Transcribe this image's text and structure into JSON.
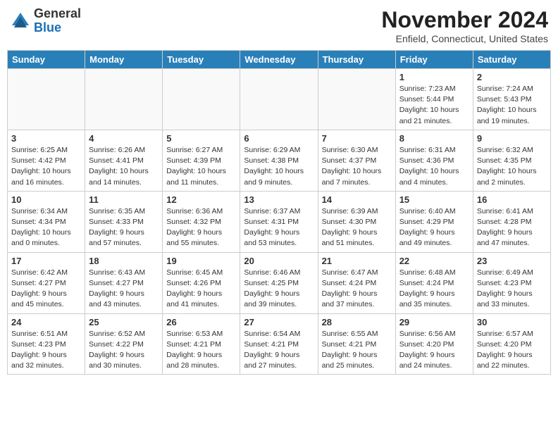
{
  "header": {
    "logo_general": "General",
    "logo_blue": "Blue",
    "month_title": "November 2024",
    "location": "Enfield, Connecticut, United States"
  },
  "days_of_week": [
    "Sunday",
    "Monday",
    "Tuesday",
    "Wednesday",
    "Thursday",
    "Friday",
    "Saturday"
  ],
  "weeks": [
    [
      {
        "day": "",
        "details": ""
      },
      {
        "day": "",
        "details": ""
      },
      {
        "day": "",
        "details": ""
      },
      {
        "day": "",
        "details": ""
      },
      {
        "day": "",
        "details": ""
      },
      {
        "day": "1",
        "details": "Sunrise: 7:23 AM\nSunset: 5:44 PM\nDaylight: 10 hours and 21 minutes."
      },
      {
        "day": "2",
        "details": "Sunrise: 7:24 AM\nSunset: 5:43 PM\nDaylight: 10 hours and 19 minutes."
      }
    ],
    [
      {
        "day": "3",
        "details": "Sunrise: 6:25 AM\nSunset: 4:42 PM\nDaylight: 10 hours and 16 minutes."
      },
      {
        "day": "4",
        "details": "Sunrise: 6:26 AM\nSunset: 4:41 PM\nDaylight: 10 hours and 14 minutes."
      },
      {
        "day": "5",
        "details": "Sunrise: 6:27 AM\nSunset: 4:39 PM\nDaylight: 10 hours and 11 minutes."
      },
      {
        "day": "6",
        "details": "Sunrise: 6:29 AM\nSunset: 4:38 PM\nDaylight: 10 hours and 9 minutes."
      },
      {
        "day": "7",
        "details": "Sunrise: 6:30 AM\nSunset: 4:37 PM\nDaylight: 10 hours and 7 minutes."
      },
      {
        "day": "8",
        "details": "Sunrise: 6:31 AM\nSunset: 4:36 PM\nDaylight: 10 hours and 4 minutes."
      },
      {
        "day": "9",
        "details": "Sunrise: 6:32 AM\nSunset: 4:35 PM\nDaylight: 10 hours and 2 minutes."
      }
    ],
    [
      {
        "day": "10",
        "details": "Sunrise: 6:34 AM\nSunset: 4:34 PM\nDaylight: 10 hours and 0 minutes."
      },
      {
        "day": "11",
        "details": "Sunrise: 6:35 AM\nSunset: 4:33 PM\nDaylight: 9 hours and 57 minutes."
      },
      {
        "day": "12",
        "details": "Sunrise: 6:36 AM\nSunset: 4:32 PM\nDaylight: 9 hours and 55 minutes."
      },
      {
        "day": "13",
        "details": "Sunrise: 6:37 AM\nSunset: 4:31 PM\nDaylight: 9 hours and 53 minutes."
      },
      {
        "day": "14",
        "details": "Sunrise: 6:39 AM\nSunset: 4:30 PM\nDaylight: 9 hours and 51 minutes."
      },
      {
        "day": "15",
        "details": "Sunrise: 6:40 AM\nSunset: 4:29 PM\nDaylight: 9 hours and 49 minutes."
      },
      {
        "day": "16",
        "details": "Sunrise: 6:41 AM\nSunset: 4:28 PM\nDaylight: 9 hours and 47 minutes."
      }
    ],
    [
      {
        "day": "17",
        "details": "Sunrise: 6:42 AM\nSunset: 4:27 PM\nDaylight: 9 hours and 45 minutes."
      },
      {
        "day": "18",
        "details": "Sunrise: 6:43 AM\nSunset: 4:27 PM\nDaylight: 9 hours and 43 minutes."
      },
      {
        "day": "19",
        "details": "Sunrise: 6:45 AM\nSunset: 4:26 PM\nDaylight: 9 hours and 41 minutes."
      },
      {
        "day": "20",
        "details": "Sunrise: 6:46 AM\nSunset: 4:25 PM\nDaylight: 9 hours and 39 minutes."
      },
      {
        "day": "21",
        "details": "Sunrise: 6:47 AM\nSunset: 4:24 PM\nDaylight: 9 hours and 37 minutes."
      },
      {
        "day": "22",
        "details": "Sunrise: 6:48 AM\nSunset: 4:24 PM\nDaylight: 9 hours and 35 minutes."
      },
      {
        "day": "23",
        "details": "Sunrise: 6:49 AM\nSunset: 4:23 PM\nDaylight: 9 hours and 33 minutes."
      }
    ],
    [
      {
        "day": "24",
        "details": "Sunrise: 6:51 AM\nSunset: 4:23 PM\nDaylight: 9 hours and 32 minutes."
      },
      {
        "day": "25",
        "details": "Sunrise: 6:52 AM\nSunset: 4:22 PM\nDaylight: 9 hours and 30 minutes."
      },
      {
        "day": "26",
        "details": "Sunrise: 6:53 AM\nSunset: 4:21 PM\nDaylight: 9 hours and 28 minutes."
      },
      {
        "day": "27",
        "details": "Sunrise: 6:54 AM\nSunset: 4:21 PM\nDaylight: 9 hours and 27 minutes."
      },
      {
        "day": "28",
        "details": "Sunrise: 6:55 AM\nSunset: 4:21 PM\nDaylight: 9 hours and 25 minutes."
      },
      {
        "day": "29",
        "details": "Sunrise: 6:56 AM\nSunset: 4:20 PM\nDaylight: 9 hours and 24 minutes."
      },
      {
        "day": "30",
        "details": "Sunrise: 6:57 AM\nSunset: 4:20 PM\nDaylight: 9 hours and 22 minutes."
      }
    ]
  ]
}
